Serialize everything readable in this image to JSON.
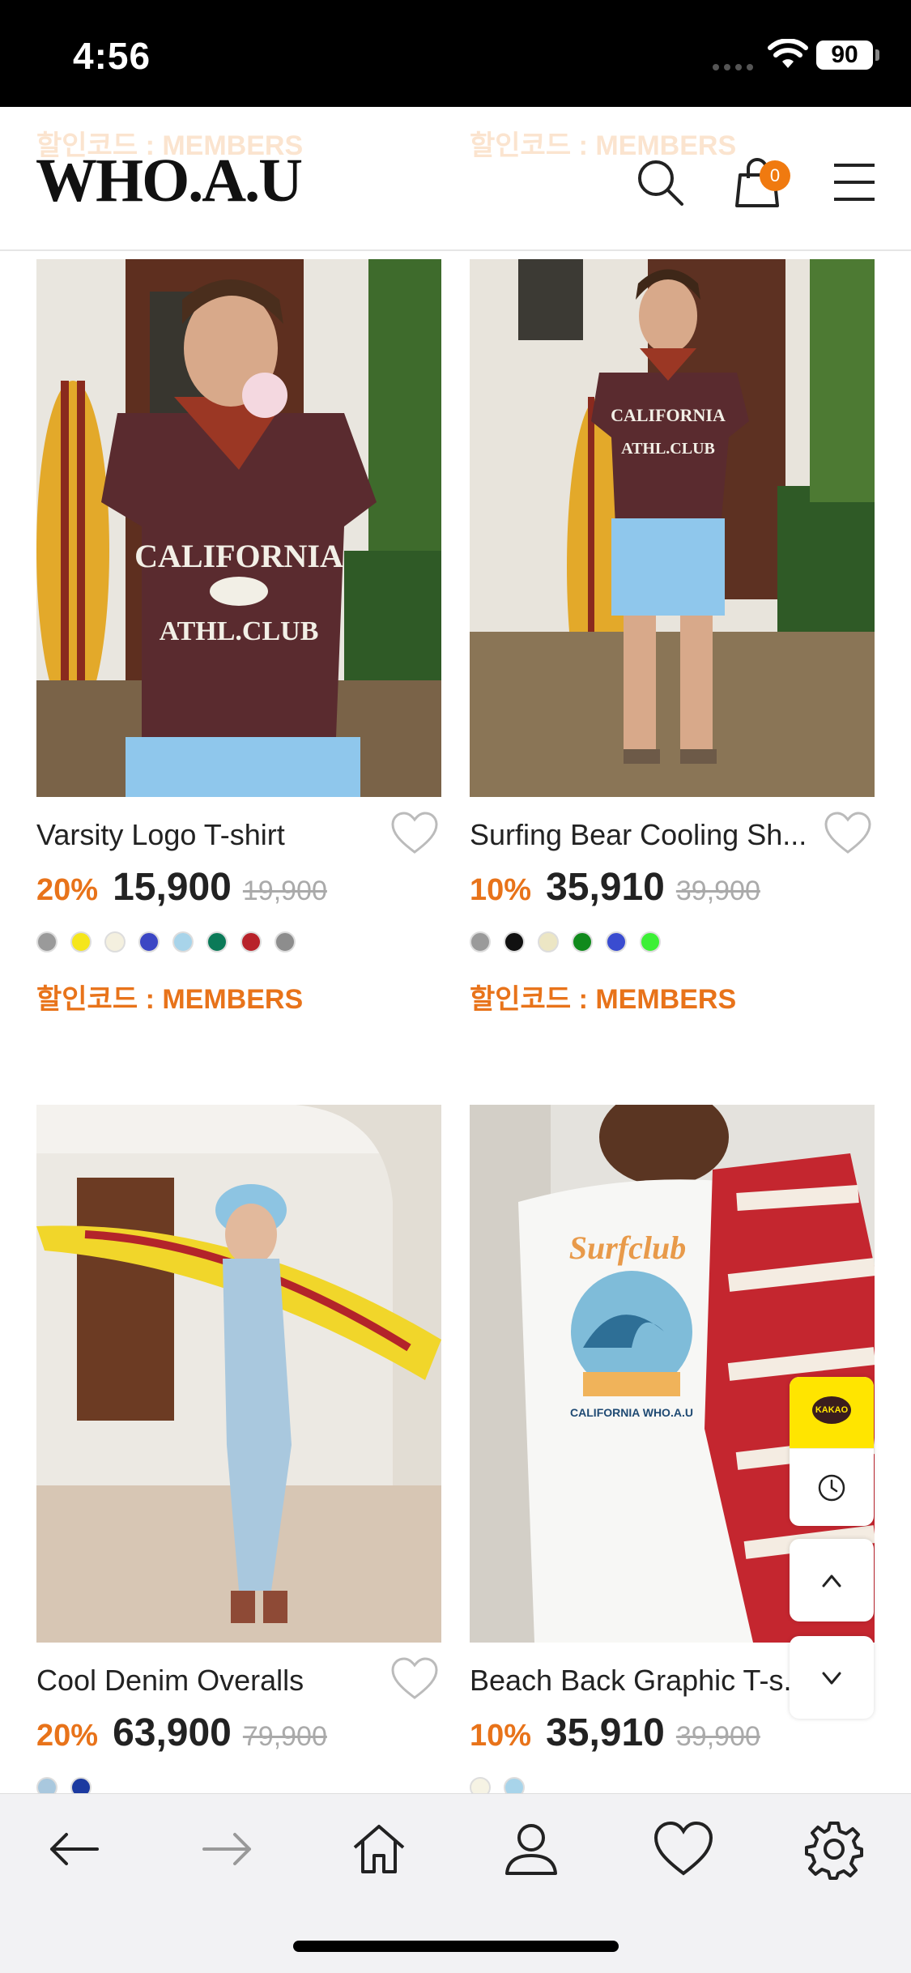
{
  "status_bar": {
    "time": "4:56",
    "battery": "90"
  },
  "header": {
    "logo": "WHO.A.U",
    "ghost_coupon_left": "할인코드 : MEMBERS",
    "ghost_coupon_right": "할인코드 : MEMBERS",
    "cart_count": "0",
    "icons": [
      "search-icon",
      "cart-icon",
      "menu-icon"
    ]
  },
  "products": [
    {
      "name": "Varsity Logo T-shirt",
      "discount": "20%",
      "price": "15,900",
      "original_price": "19,900",
      "colors": [
        "#9a9a9a",
        "#f5e61c",
        "#f4f0df",
        "#3b46c4",
        "#a8d4ea",
        "#0b7a58",
        "#b8222a",
        "#8d8d8d"
      ],
      "coupon": "할인코드 : MEMBERS"
    },
    {
      "name": "Surfing Bear Cooling Sh...",
      "discount": "10%",
      "price": "35,910",
      "original_price": "39,900",
      "colors": [
        "#9a9a9a",
        "#111111",
        "#ece6c4",
        "#108a1c",
        "#3a4cd0",
        "#3cf036"
      ],
      "coupon": "할인코드 : MEMBERS"
    },
    {
      "name": "Cool Denim Overalls",
      "discount": "20%",
      "price": "63,900",
      "original_price": "79,900",
      "colors": [
        "#a9c8de",
        "#1c3aa0"
      ]
    },
    {
      "name": "Beach Back Graphic T-s...",
      "discount": "10%",
      "price": "35,910",
      "original_price": "39,900",
      "colors": [
        "#f6f3e4",
        "#a8d4ea"
      ]
    }
  ],
  "floating": {
    "kakao_label": "KAKAO"
  },
  "toolbar": {
    "icons": [
      "back-arrow-icon",
      "forward-arrow-icon",
      "home-icon",
      "account-icon",
      "wishlist-heart-icon",
      "settings-gear-icon"
    ]
  },
  "colors": {
    "accent": "#e8731a",
    "badge": "#f07a10",
    "kakao": "#ffe500"
  }
}
